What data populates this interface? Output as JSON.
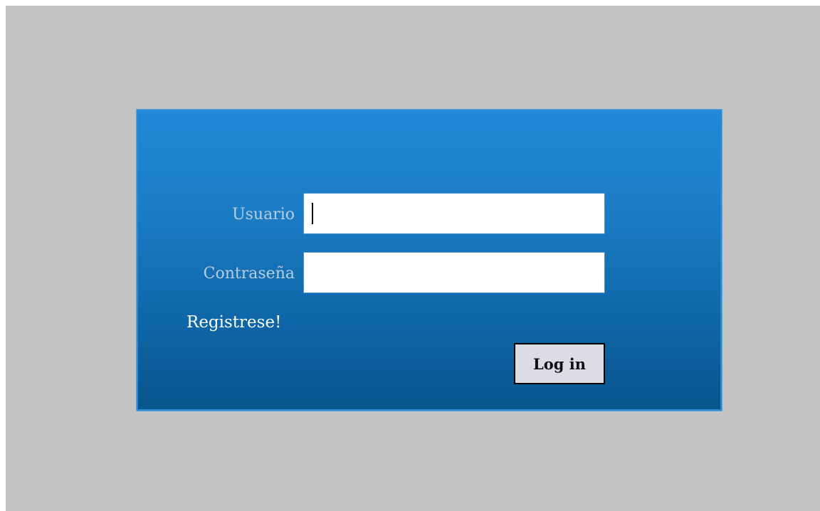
{
  "login": {
    "username_label": "Usuario",
    "username_value": "",
    "password_label": "Contraseña",
    "password_value": "",
    "register_link": "Registrese!",
    "login_button": "Log in"
  },
  "colors": {
    "page_background": "#c3c3c3",
    "panel_gradient_top": "#2089d8",
    "panel_gradient_bottom": "#07558c",
    "label_color": "#b9cde0",
    "link_color": "#ffffff",
    "button_background": "#dcdde4"
  }
}
